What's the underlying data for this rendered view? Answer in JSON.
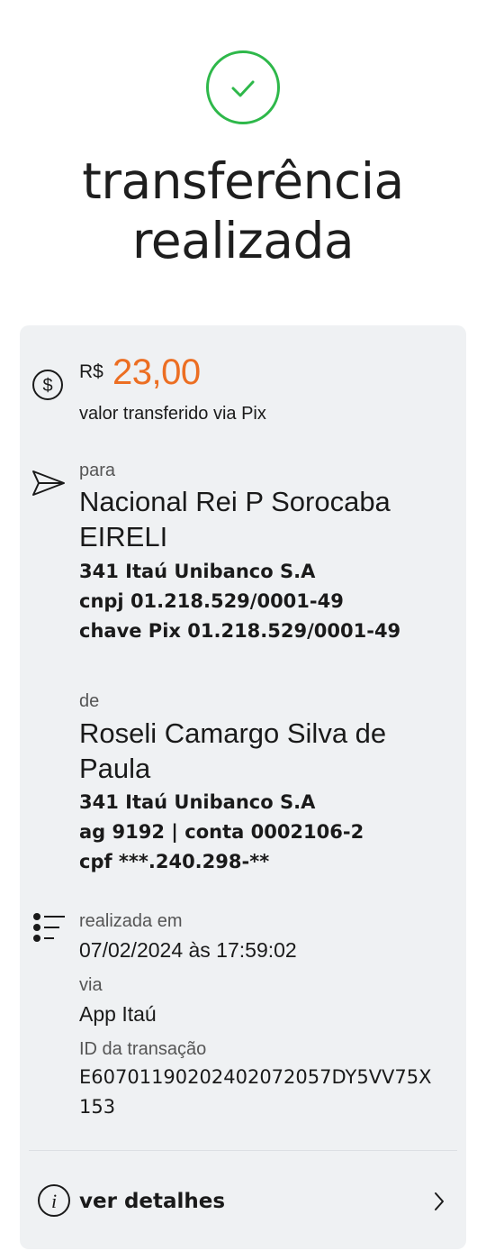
{
  "header": {
    "title_line1": "transferência",
    "title_line2": "realizada"
  },
  "amount": {
    "currency": "R$",
    "value": "23,00",
    "label": "valor transferido via Pix",
    "color": "#ec6e22"
  },
  "recipient": {
    "label": "para",
    "name_line1": "Nacional Rei P Sorocaba",
    "name_line2": "EIRELI",
    "bank": "341 Itaú Unibanco S.A",
    "cnpj": "cnpj 01.218.529/0001-49",
    "pix_key": "chave Pix 01.218.529/0001-49"
  },
  "sender": {
    "label": "de",
    "name_line1": "Roseli Camargo Silva de",
    "name_line2": "Paula",
    "bank": "341 Itaú Unibanco S.A",
    "account": "ag 9192 | conta 0002106-2",
    "cpf": "cpf ***.240.298-**"
  },
  "info": {
    "date_label": "realizada em",
    "date_value": "07/02/2024 às 17:59:02",
    "via_label": "via",
    "via_value": "App Itaú",
    "id_label": "ID da transação",
    "id_line1": "E60701190202402072057DY5VV75X",
    "id_line2": "153"
  },
  "details": {
    "label": "ver detalhes"
  },
  "icons": {
    "success": "check-circle-icon",
    "amount": "dollar-circle-icon",
    "recipient": "send-icon",
    "info": "list-icon",
    "details": "info-icon",
    "chevron": "chevron-right-icon"
  },
  "colors": {
    "success": "#2eb84a",
    "card_bg": "#eff1f3"
  }
}
